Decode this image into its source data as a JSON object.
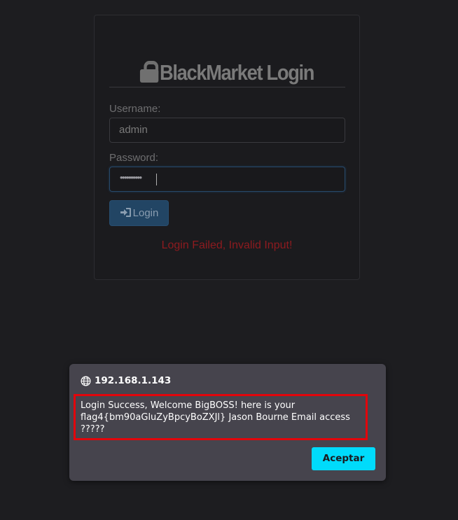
{
  "login": {
    "title": "BlackMarket Login",
    "username_label": "Username:",
    "username_value": "admin",
    "password_label": "Password:",
    "password_masked": "••••••••••",
    "login_button": "Login",
    "error_message": "Login Failed, Invalid Input!"
  },
  "dialog": {
    "origin": "192.168.1.143",
    "message": "Login Success, Welcome BigBOSS! here is your flag4{bm90aGluZyBpcyBoZXJl} Jason Bourne Email access ?????",
    "accept_button": "Aceptar"
  },
  "colors": {
    "accent": "#00dbfb",
    "error": "#8e1b1f",
    "highlight_border": "#e2050b"
  },
  "icons": {
    "title_icon": "lock-icon",
    "login_icon": "sign-in-icon",
    "origin_icon": "globe-icon"
  }
}
